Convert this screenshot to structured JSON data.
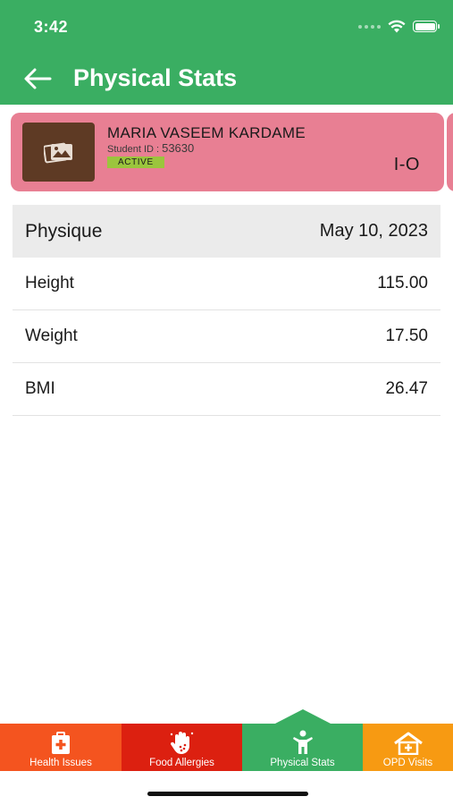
{
  "status_bar": {
    "time": "3:42"
  },
  "header": {
    "title": "Physical Stats",
    "back_icon": "arrow-left-icon"
  },
  "student": {
    "name": "MARIA VASEEM KARDAME",
    "id_label": "Student ID :",
    "id_value": "53630",
    "status": "ACTIVE",
    "class": "I-O",
    "avatar_icon": "image-placeholder-icon"
  },
  "stats": {
    "header_label": "Physique",
    "header_date": "May 10, 2023",
    "rows": [
      {
        "label": "Height",
        "value": "115.00"
      },
      {
        "label": "Weight",
        "value": "17.50"
      },
      {
        "label": "BMI",
        "value": "26.47"
      }
    ]
  },
  "tabs": [
    {
      "label": "Health Issues",
      "icon": "medical-kit-icon",
      "color": "#f4541f"
    },
    {
      "label": "Food Allergies",
      "icon": "allergy-hand-icon",
      "color": "#dc2010"
    },
    {
      "label": "Physical Stats",
      "icon": "person-icon",
      "color": "#3aae62",
      "selected": true
    },
    {
      "label": "OPD Visits",
      "icon": "hospital-icon",
      "color": "#f79a12"
    }
  ],
  "colors": {
    "primary": "#3aae62",
    "card": "#e87f93",
    "badge": "#9bc53d",
    "avatar_bg": "#5e3a24"
  }
}
